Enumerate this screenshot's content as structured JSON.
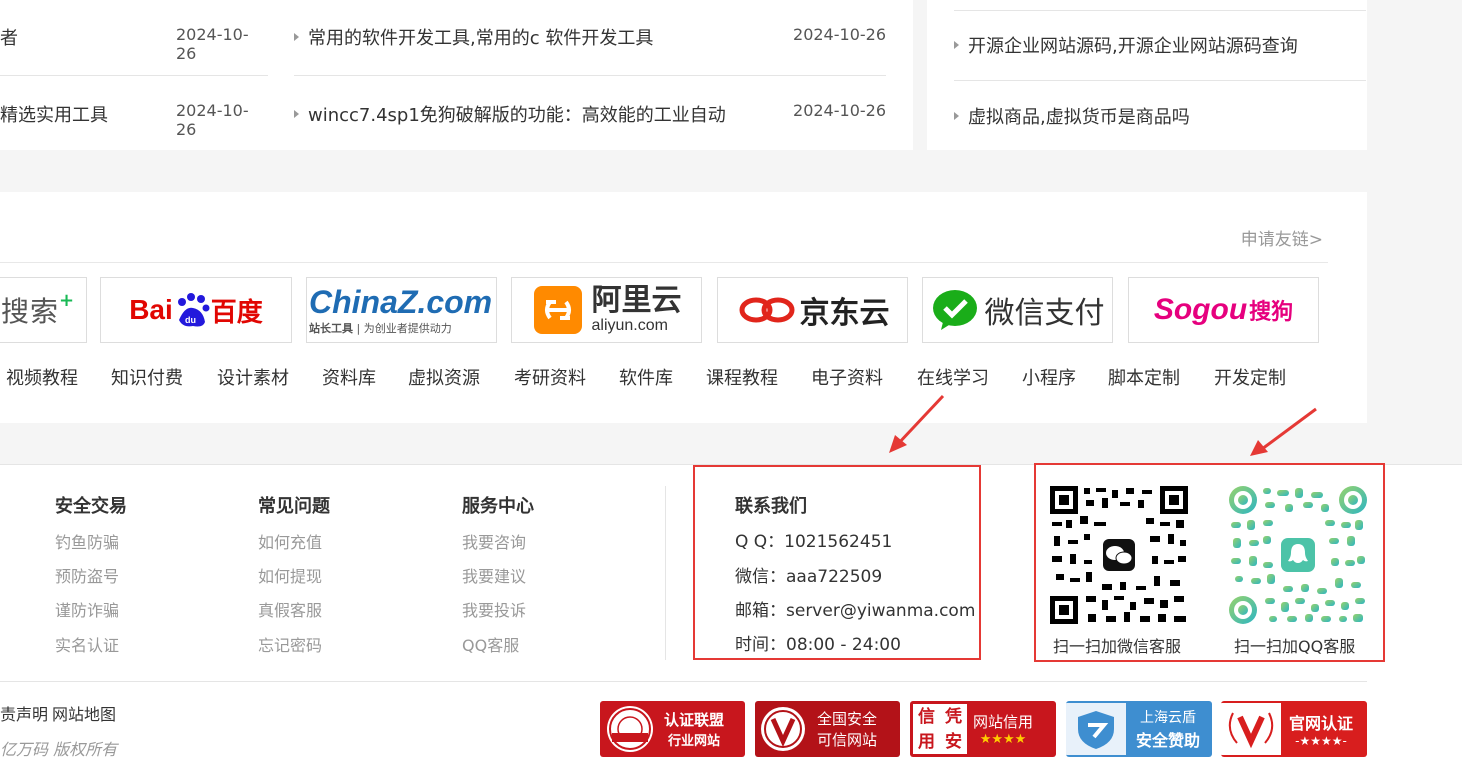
{
  "news_left": [
    {
      "title": "&#x8005;",
      "date": "2024-10-26"
    },
    {
      "title": "精选实用工具",
      "date": "2024-10-26"
    }
  ],
  "news_mid": [
    {
      "title": "常用的软件开发工具,常用的c 软件开发工具",
      "date": "2024-10-26"
    },
    {
      "title": "wincc7.4sp1免狗破解版的功能：高效能的工业自动",
      "date": "2024-10-26"
    }
  ],
  "news_right": [
    {
      "title": "开源企业网站源码,开源企业网站源码查询"
    },
    {
      "title": "虚拟商品,虚拟货币是商品吗"
    }
  ],
  "friend_links": {
    "apply": "申请友链>",
    "logos": [
      {
        "text": "搜索",
        "icon": "360-search-logo"
      },
      {
        "text_a": "Bai",
        "text_b": "百度",
        "icon": "baidu-logo"
      },
      {
        "text_a": "ChinaZ.com",
        "text_b": "站长工具",
        "text_c": "为创业者提供动力",
        "icon": "chinaz-logo"
      },
      {
        "text_a": "阿里云",
        "text_b": "aliyun.com",
        "icon": "aliyun-logo"
      },
      {
        "text": "京东云",
        "icon": "jdcloud-logo"
      },
      {
        "text": "微信支付",
        "icon": "wechat-pay-logo"
      },
      {
        "text_a": "Sogou",
        "text_b": "搜狗",
        "icon": "sogou-logo"
      }
    ],
    "categories": [
      "视频教程",
      "知识付费",
      "设计素材",
      "资料库",
      "虚拟资源",
      "考研资料",
      "软件库",
      "课程教程",
      "电子资料",
      "在线学习",
      "小程序",
      "脚本定制",
      "开发定制"
    ]
  },
  "footer": {
    "columns": [
      {
        "head": "安全交易",
        "items": [
          "钓鱼防骗",
          "预防盗号",
          "谨防诈骗",
          "实名认证"
        ]
      },
      {
        "head": "常见问题",
        "items": [
          "如何充值",
          "如何提现",
          "真假客服",
          "忘记密码"
        ]
      },
      {
        "head": "服务中心",
        "items": [
          "我要咨询",
          "我要建议",
          "我要投诉",
          "QQ客服"
        ]
      }
    ],
    "contact": {
      "head": "联系我们",
      "qq": "Q Q：1021562451",
      "wechat": "微信：aaa722509",
      "email": "邮箱：server@yiwanma.com",
      "time": "时间：08:00 - 24:00"
    },
    "qr": {
      "wechat_label": "扫一扫加微信客服",
      "qq_label": "扫一扫加QQ客服"
    },
    "bottom_links": [
      "责声明",
      "网站地图"
    ],
    "copyright": "亿万码 版权所有",
    "badges": [
      {
        "line1": "认证联盟",
        "line2": "行业网站"
      },
      {
        "line1": "全国安全",
        "line2": "可信网站"
      },
      {
        "seal": "信凭用安",
        "line1": "网站信用",
        "line2": "★★★★"
      },
      {
        "line1": "上海云盾",
        "line2": "安全赞助"
      },
      {
        "line1": "官网认证",
        "line2": "-★★★★-"
      }
    ]
  },
  "colors": {
    "accent_red": "#e53935",
    "badge_red": "#c8161d",
    "cloud_blue": "#3e8ed0"
  }
}
